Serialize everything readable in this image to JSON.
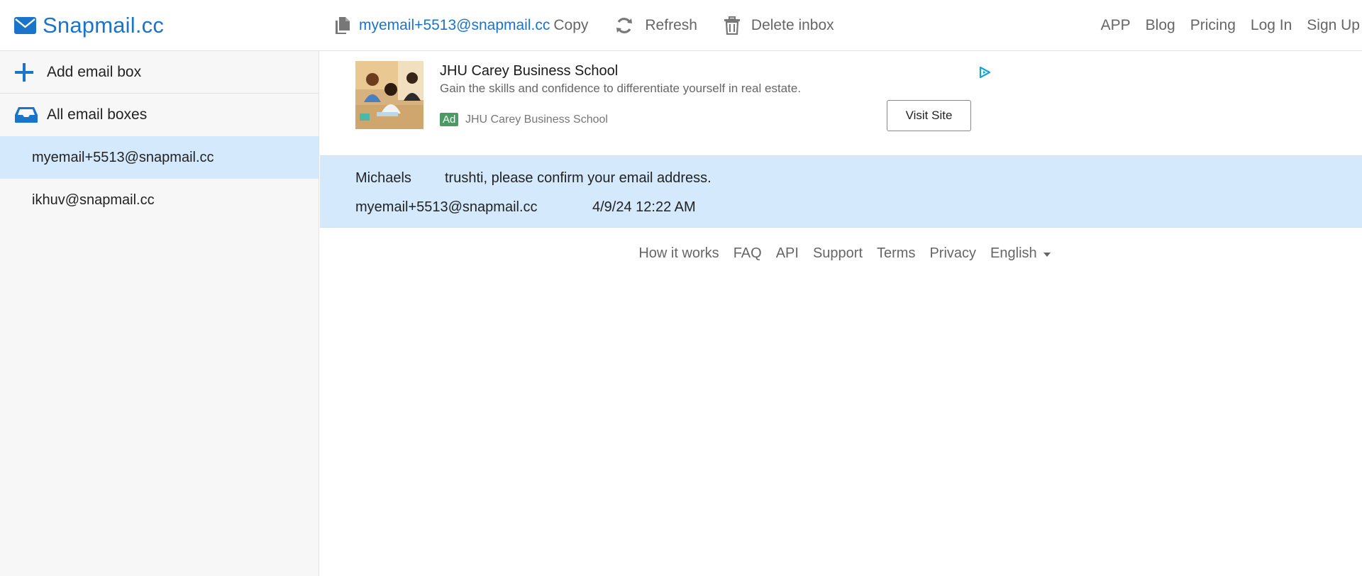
{
  "header": {
    "logo_text": "Snapmail.cc",
    "current_email": "myemail+5513@snapmail.cc",
    "copy_label": "Copy",
    "refresh_label": "Refresh",
    "delete_label": "Delete inbox",
    "nav": [
      "APP",
      "Blog",
      "Pricing",
      "Log In",
      "Sign Up"
    ]
  },
  "sidebar": {
    "add_label": "Add email box",
    "all_label": "All email boxes",
    "boxes": [
      {
        "address": "myemail+5513@snapmail.cc",
        "active": true
      },
      {
        "address": "ikhuv@snapmail.cc",
        "active": false
      }
    ]
  },
  "ad": {
    "title": "JHU Carey Business School",
    "description": "Gain the skills and confidence to differentiate yourself in real estate.",
    "badge": "Ad",
    "source": "JHU Carey Business School",
    "button": "Visit Site"
  },
  "message": {
    "from": "Michaels",
    "subject": "trushti, please confirm your email address.",
    "to": "myemail+5513@snapmail.cc",
    "date": "4/9/24 12:22 AM"
  },
  "footer": {
    "links": [
      "How it works",
      "FAQ",
      "API",
      "Support",
      "Terms",
      "Privacy"
    ],
    "language": "English"
  },
  "colors": {
    "brand": "#1a74c9",
    "selected_bg": "#d4eafc",
    "ad_badge": "#4b9a62"
  },
  "icons": [
    "envelope-icon",
    "copy-icon",
    "refresh-icon",
    "trash-icon",
    "plus-icon",
    "inbox-icon",
    "ad-choices-icon",
    "caret-down-icon"
  ]
}
